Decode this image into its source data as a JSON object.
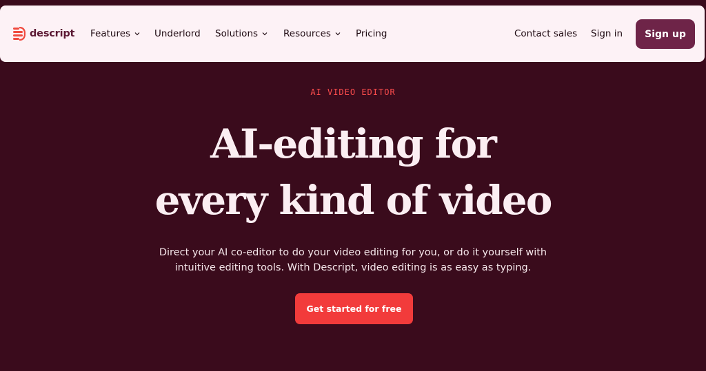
{
  "brand": {
    "name": "descript",
    "logo_icon": "descript-logo-icon",
    "logo_color": "#f04a3e"
  },
  "nav": {
    "items": [
      {
        "label": "Features",
        "has_dropdown": true
      },
      {
        "label": "Underlord",
        "has_dropdown": false
      },
      {
        "label": "Solutions",
        "has_dropdown": true
      },
      {
        "label": "Resources",
        "has_dropdown": true
      },
      {
        "label": "Pricing",
        "has_dropdown": false
      }
    ],
    "contact_sales": "Contact sales",
    "sign_in": "Sign in",
    "sign_up": "Sign up"
  },
  "hero": {
    "eyebrow": "AI VIDEO EDITOR",
    "headline_line1": "AI-editing for",
    "headline_line2": "every kind of video",
    "subtext_line1": "Direct your AI co-editor to do your video editing for you, or do it yourself with",
    "subtext_line2": "intuitive editing tools. With Descript, video editing is as easy as typing.",
    "cta": "Get started for free"
  },
  "colors": {
    "background": "#3a0b1c",
    "navbar_bg": "#fdf2f6",
    "accent_red": "#f23b3b",
    "signup_bg": "#6e2448",
    "headline": "#fbeef2"
  }
}
